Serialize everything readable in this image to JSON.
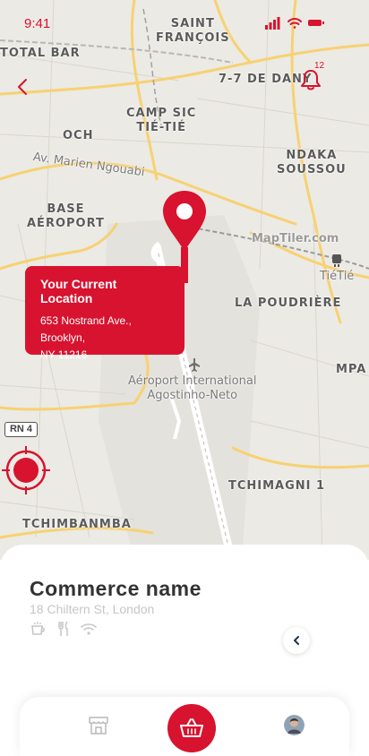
{
  "status_bar": {
    "time": "9:41"
  },
  "header": {
    "notification_count": "12"
  },
  "map": {
    "labels": {
      "saint_francois": "SAINT\nFRANÇOIS",
      "total_bar": "TOTAL BAR",
      "seven_de_dany": "7-7 DE DANY",
      "camp_sic": "CAMP SIC\nTIÉ-TIÉ",
      "och": "OCH",
      "ndaka": "NDAKA\nSOUSSOU",
      "av_marien": "Av. Marien Ngouabi",
      "base_aeroport": "BASE\nAÉROPORT",
      "maptiler": "MapTiler.com",
      "tietie": "TiéTié",
      "la_poudriere": "LA POUDRIÈRE",
      "mpa": "MPA",
      "aeroport": "Aéroport International\nAgostinho-Neto",
      "rn4": "RN 4",
      "tchimagni": "TCHIMAGNI 1",
      "tchimbanmba": "TCHIMBANMBA"
    }
  },
  "location_card": {
    "title": "Your Current Location",
    "address_line1": "653 Nostrand Ave.,",
    "address_line2": "Brooklyn,",
    "address_line3": "NY 11216"
  },
  "commerce": {
    "name": "Commerce name",
    "address": "18 Chiltern St, London",
    "amenities": [
      "coffee-icon",
      "cutlery-icon",
      "wifi-icon"
    ]
  },
  "colors": {
    "accent": "#d7132f",
    "text": "#333333",
    "muted": "#c6c6c6"
  }
}
